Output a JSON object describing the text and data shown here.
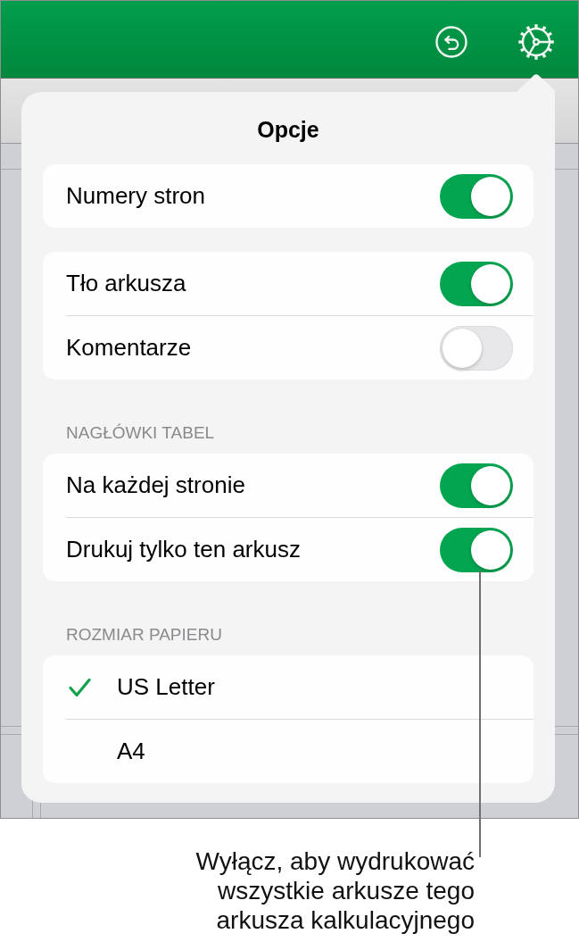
{
  "popover": {
    "title": "Opcje",
    "groups": [
      {
        "rows": [
          {
            "kind": "toggle",
            "label": "Numery stron",
            "on": true
          }
        ]
      },
      {
        "rows": [
          {
            "kind": "toggle",
            "label": "Tło arkusza",
            "on": true
          },
          {
            "kind": "toggle",
            "label": "Komentarze",
            "on": false
          }
        ]
      },
      {
        "header": "NAGŁÓWKI TABEL",
        "rows": [
          {
            "kind": "toggle",
            "label": "Na każdej stronie",
            "on": true
          },
          {
            "kind": "toggle",
            "label": "Drukuj tylko ten arkusz",
            "on": true
          }
        ]
      },
      {
        "header": "ROZMIAR PAPIERU",
        "rows": [
          {
            "kind": "choice",
            "label": "US Letter",
            "selected": true
          },
          {
            "kind": "choice",
            "label": "A4",
            "selected": false
          }
        ]
      }
    ]
  },
  "callout": {
    "text": "Wyłącz, aby wydrukować wszystkie arkusze tego arkusza kalkulacyjnego"
  }
}
